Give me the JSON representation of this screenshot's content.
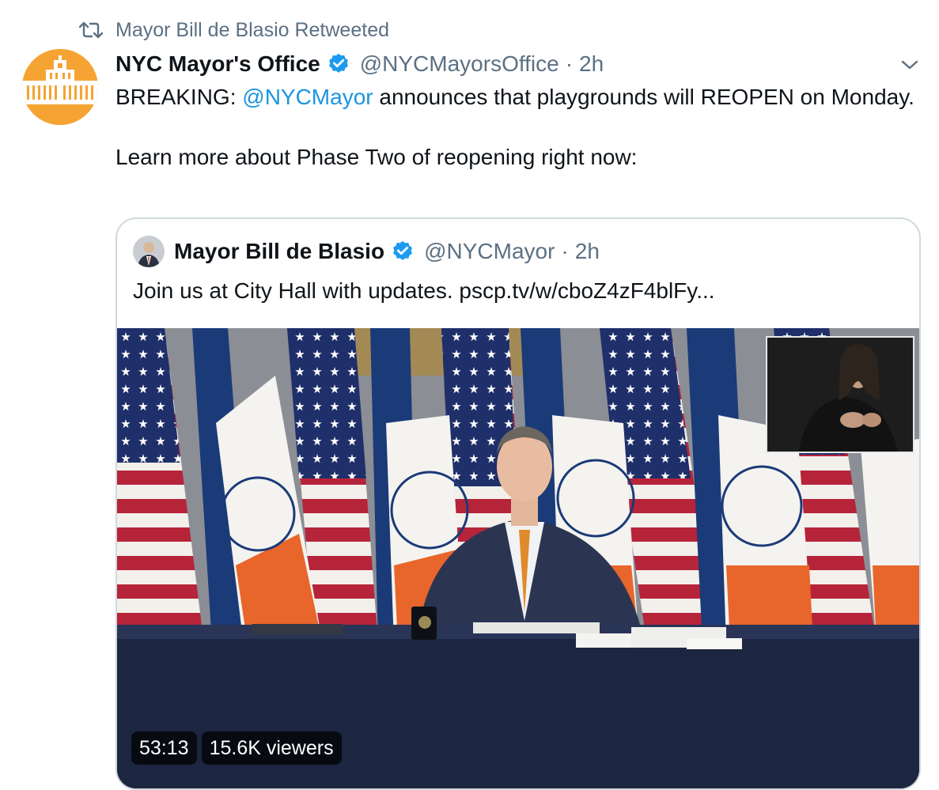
{
  "retweet": {
    "icon": "retweet-icon",
    "label": "Mayor Bill de Blasio Retweeted"
  },
  "tweet": {
    "author_name": "NYC Mayor's Office",
    "author_handle": "@NYCMayorsOffice",
    "separator": "·",
    "time": "2h",
    "verified_icon": "verified-badge-icon",
    "more_icon": "chevron-down-icon",
    "text_line1_prefix": "BREAKING: ",
    "text_mention": "@NYCMayor",
    "text_line1_suffix": " announces that playgrounds will REOPEN on Monday.",
    "text_line2": "Learn more about Phase Two of reopening right now:"
  },
  "quoted_tweet": {
    "author_name": "Mayor Bill de Blasio",
    "author_handle": "@NYCMayor",
    "separator": "·",
    "time": "2h",
    "text": "Join us at City Hall with updates. pscp.tv/w/cboZ4zF4blFy..."
  },
  "video": {
    "duration": "53:13",
    "viewers": "15.6K viewers"
  },
  "colors": {
    "link_blue": "#1b95e0",
    "verified_blue": "#1d9bf0",
    "secondary_text": "#5b7083",
    "avatar_orange": "#f5a433"
  }
}
